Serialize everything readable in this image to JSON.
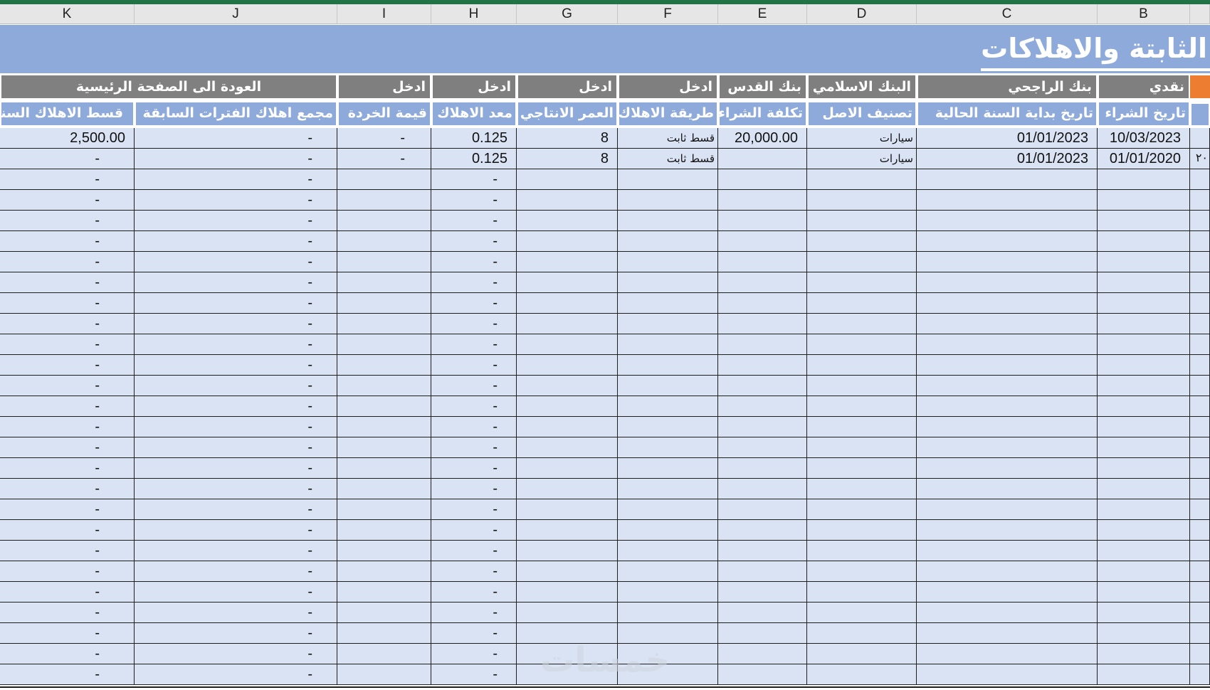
{
  "columns": [
    "K",
    "J",
    "I",
    "H",
    "G",
    "F",
    "E",
    "D",
    "C",
    "B"
  ],
  "title": "الثابتة والاهلاكات",
  "bank_row": {
    "b": "نقدي",
    "c": "بنك الراجحي",
    "d": "البنك الاسلامي",
    "e": "بنك القدس",
    "f": "ادخل",
    "g": "ادخل",
    "h": "ادخل",
    "i": "ادخل",
    "jk": "العودة الى الصفحة الرئيسية"
  },
  "headers": {
    "b": "تاريخ الشراء",
    "c": "تاريخ بداية السنة الحالية",
    "d": "تصنيف الاصل",
    "e": "تكلفة الشراء",
    "f": "طريقة الاهلاك",
    "g": "العمر الانتاجي",
    "h": "معد الاهلاك",
    "i": "قيمة الخردة",
    "j": "مجمع اهلاك الفترات السابقة",
    "k": "قسط الاهلاك السنوي"
  },
  "rows": [
    {
      "a": "",
      "b": "10/03/2023",
      "c": "01/01/2023",
      "d": "سيارات",
      "e": "20,000.00",
      "f": "قسط ثابت",
      "g": "8",
      "h": "0.125",
      "i": "-",
      "j": "-",
      "k": "2,500.00"
    },
    {
      "a": "٢٠",
      "b": "01/01/2020",
      "c": "01/01/2023",
      "d": "سيارات",
      "e": "",
      "f": "قسط ثابت",
      "g": "8",
      "h": "0.125",
      "i": "-",
      "j": "-",
      "k": "-"
    }
  ],
  "empty_row_values": {
    "h": "-",
    "j": "-",
    "k": "-"
  },
  "watermark": "خمسات"
}
